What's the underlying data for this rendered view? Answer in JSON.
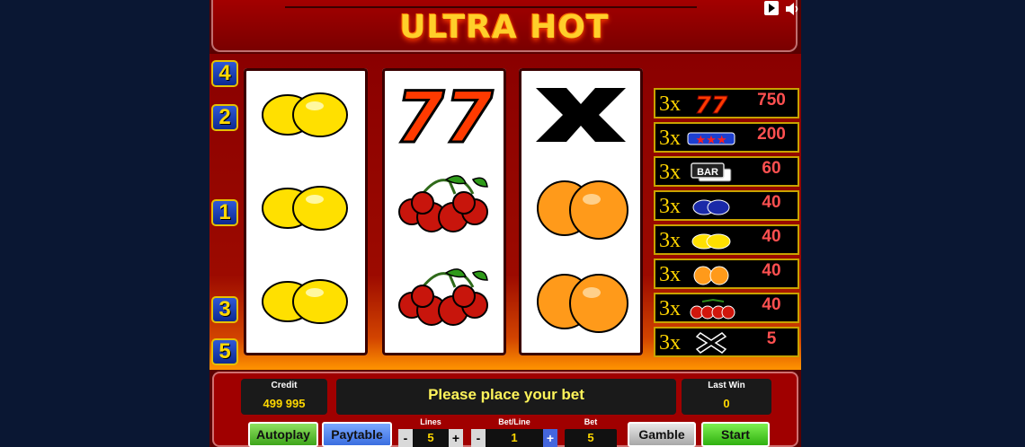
{
  "title": "ULTRA HOT",
  "top_icons": [
    "play-icon",
    "speaker-icon"
  ],
  "colors": {
    "background": "#0a1733",
    "frame": "#a00000",
    "accent": "#ffd800",
    "payout": "#ff5050"
  },
  "line_badges": {
    "top": [
      "4",
      "2"
    ],
    "middle": [
      "1"
    ],
    "bottom": [
      "3",
      "5"
    ]
  },
  "reels": [
    [
      "lemon",
      "lemon",
      "lemon"
    ],
    [
      "seven",
      "cherry",
      "cherry"
    ],
    [
      "cross",
      "orange",
      "orange"
    ]
  ],
  "paytable": [
    {
      "mult": "3x",
      "symbol": "seven",
      "value": "750"
    },
    {
      "mult": "3x",
      "symbol": "star",
      "value": "200"
    },
    {
      "mult": "3x",
      "symbol": "bar",
      "symbol_text": "BAR",
      "value": "60"
    },
    {
      "mult": "3x",
      "symbol": "plum",
      "value": "40"
    },
    {
      "mult": "3x",
      "symbol": "lemon",
      "value": "40"
    },
    {
      "mult": "3x",
      "symbol": "orange",
      "value": "40"
    },
    {
      "mult": "3x",
      "symbol": "cherry",
      "value": "40"
    },
    {
      "mult": "3x",
      "symbol": "cross",
      "value": "5"
    }
  ],
  "credit": {
    "label": "Credit",
    "value": "499 995"
  },
  "message": "Please place your bet",
  "last_win": {
    "label": "Last Win",
    "value": "0"
  },
  "buttons": {
    "autoplay": "Autoplay",
    "paytable": "Paytable",
    "gamble": "Gamble",
    "start": "Start"
  },
  "lines": {
    "label": "Lines",
    "value": "5",
    "minus": "-",
    "plus": "+"
  },
  "bet_line": {
    "label": "Bet/Line",
    "value": "1",
    "minus": "-",
    "plus": "+"
  },
  "bet": {
    "label": "Bet",
    "value": "5"
  }
}
